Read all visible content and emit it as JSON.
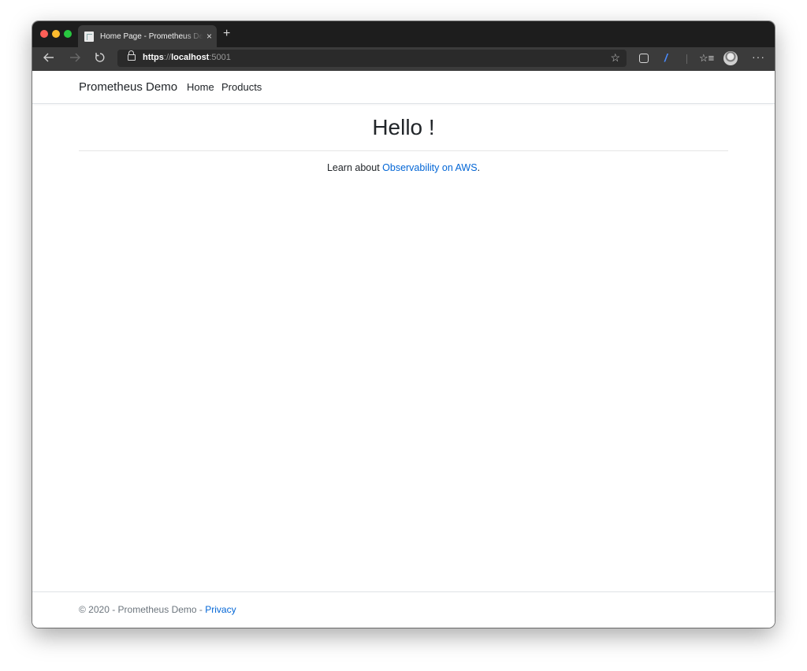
{
  "browser": {
    "tab_title": "Home Page - Prometheus Demo",
    "tab_close": "×",
    "new_tab": "+",
    "url": {
      "scheme": "https",
      "separator": "://",
      "host": "localhost",
      "port": ":5001"
    },
    "icons": {
      "back": "back-arrow-icon",
      "forward": "forward-arrow-icon",
      "reload": "reload-icon",
      "lock": "lock-icon",
      "favorite": "star-icon",
      "extension": "extension-icon",
      "pen": "pen-extension-icon",
      "favorites_list": "favorites-list-icon",
      "profile": "profile-avatar-icon",
      "more": "more-icon"
    }
  },
  "navbar": {
    "brand": "Prometheus Demo",
    "links": [
      {
        "label": "Home"
      },
      {
        "label": "Products"
      }
    ]
  },
  "main": {
    "heading": "Hello !",
    "lead_prefix": "Learn about ",
    "lead_link": "Observability on AWS",
    "lead_suffix": "."
  },
  "footer": {
    "text": "© 2020 - Prometheus Demo - ",
    "privacy_link": "Privacy"
  },
  "colors": {
    "link": "#0366d6",
    "text": "#212529",
    "browser_chrome": "#3b3b3b"
  }
}
